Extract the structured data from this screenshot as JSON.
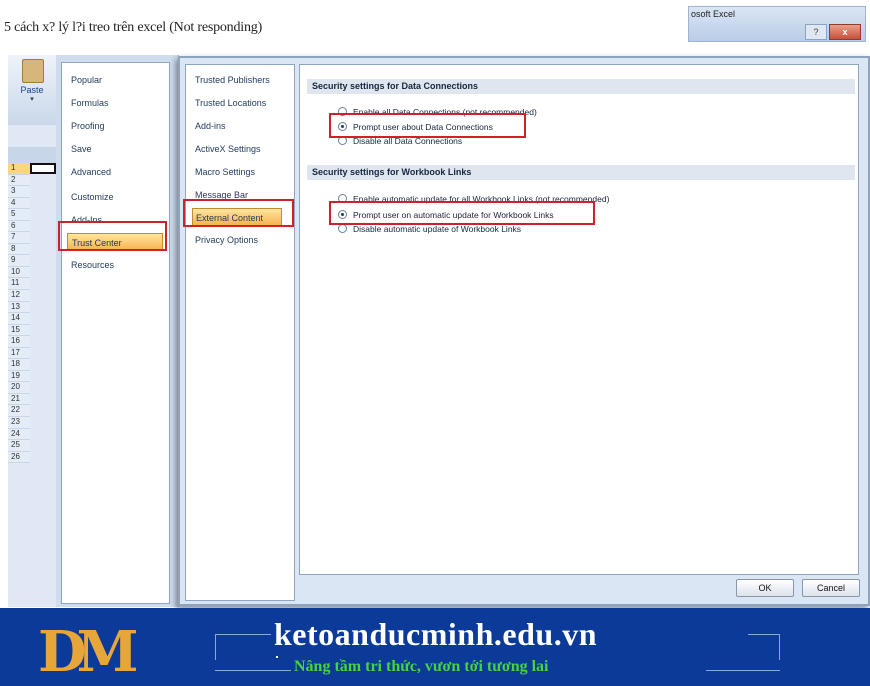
{
  "page_title": "5 cách x? lý l?i treo trên excel (Not responding)",
  "window": {
    "title_fragment": "osoft Excel",
    "help_label": "?",
    "close_label": "x"
  },
  "ribbon": {
    "paste_label": "Paste",
    "paste_arrow": "▾"
  },
  "row_numbers": [
    "1",
    "2",
    "3",
    "4",
    "5",
    "6",
    "7",
    "8",
    "9",
    "10",
    "11",
    "12",
    "13",
    "14",
    "15",
    "16",
    "17",
    "18",
    "19",
    "20",
    "21",
    "22",
    "23",
    "24",
    "25",
    "26"
  ],
  "excel_options": {
    "categories": [
      "Popular",
      "Formulas",
      "Proofing",
      "Save",
      "Advanced",
      "Customize",
      "Add-Ins",
      "Trust Center",
      "Resources"
    ],
    "selected_category": "Trust Center"
  },
  "trust_center": {
    "nav": [
      "Trusted Publishers",
      "Trusted Locations",
      "Add-ins",
      "ActiveX Settings",
      "Macro Settings",
      "Message Bar",
      "External Content",
      "Privacy Options"
    ],
    "selected_nav": "External Content",
    "data_connections": {
      "heading": "Security settings for Data Connections",
      "options": [
        "Enable all Data Connections (not recommended)",
        "Prompt user about Data Connections",
        "Disable all Data Connections"
      ],
      "selected_index": 1
    },
    "workbook_links": {
      "heading": "Security settings for Workbook Links",
      "options": [
        "Enable automatic update for all Workbook Links (not recommended)",
        "Prompt user on automatic update for Workbook Links",
        "Disable automatic update of Workbook Links"
      ],
      "selected_index": 1
    },
    "ok_label": "OK",
    "cancel_label": "Cancel"
  },
  "banner": {
    "logo_text": "DM",
    "brand": "ketoanducminh.edu.vn",
    "tagline": "Nâng tầm tri thức, vươn tới tương lai"
  },
  "colors": {
    "highlight_frame": "#d0202a",
    "selected_item": "#f7b24f",
    "banner_bg": "#0b3a99",
    "tagline": "#45d43a",
    "logo": "#e7a63a"
  }
}
